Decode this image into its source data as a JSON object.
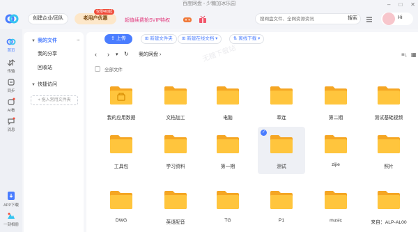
{
  "window": {
    "title": "百度网盘 - 少糖加冰乐园"
  },
  "header": {
    "enterprise_label": "创建企业/团队",
    "vip_label": "老用户优惠",
    "vip_badge": "仅限¥60起",
    "promo_text": "超值续费抢SVIP特权",
    "search_placeholder": "搜网盘文件、全网资源资讯",
    "search_button": "搜索",
    "avatar_text": "Hi"
  },
  "rail": [
    {
      "label": "首页",
      "icon": "home-cloud-icon",
      "active": true
    },
    {
      "label": "传输",
      "icon": "transfer-icon"
    },
    {
      "label": "同步",
      "icon": "sync-icon"
    },
    {
      "label": "AI看",
      "icon": "ai-icon"
    },
    {
      "label": "消息",
      "icon": "message-icon"
    },
    {
      "label": "APP下载",
      "icon": "app-download-icon"
    },
    {
      "label": "一刻相册",
      "icon": "album-icon"
    }
  ],
  "nav": {
    "my_files": "我的文件",
    "my_shares": "我的分享",
    "recycle": "回收站",
    "quick_access": "快捷访问",
    "add_quick": "+ 拖入常用文件夹"
  },
  "toolbar": {
    "upload": "上传",
    "new_folder": "新建文件夹",
    "new_online_doc": "新建在线文档",
    "offline_download": "离线下载"
  },
  "breadcrumb": {
    "current": "我的网盘"
  },
  "list": {
    "select_all": "全部文件"
  },
  "watermark": "无糖下载站",
  "folders": [
    "我的应用数据",
    "文档加工",
    "电脑",
    "奉连",
    "第二期",
    "测试基础视频",
    "工具包",
    "学习资料",
    "第一期",
    "测试",
    "zijie",
    "照片",
    "DWG",
    "英语配音",
    "TG",
    "P1",
    "music",
    "来自：ALP-AL00"
  ],
  "colors": {
    "accent": "#4a7dff",
    "folder": "#ffc53d",
    "folder_back": "#f5a623"
  }
}
